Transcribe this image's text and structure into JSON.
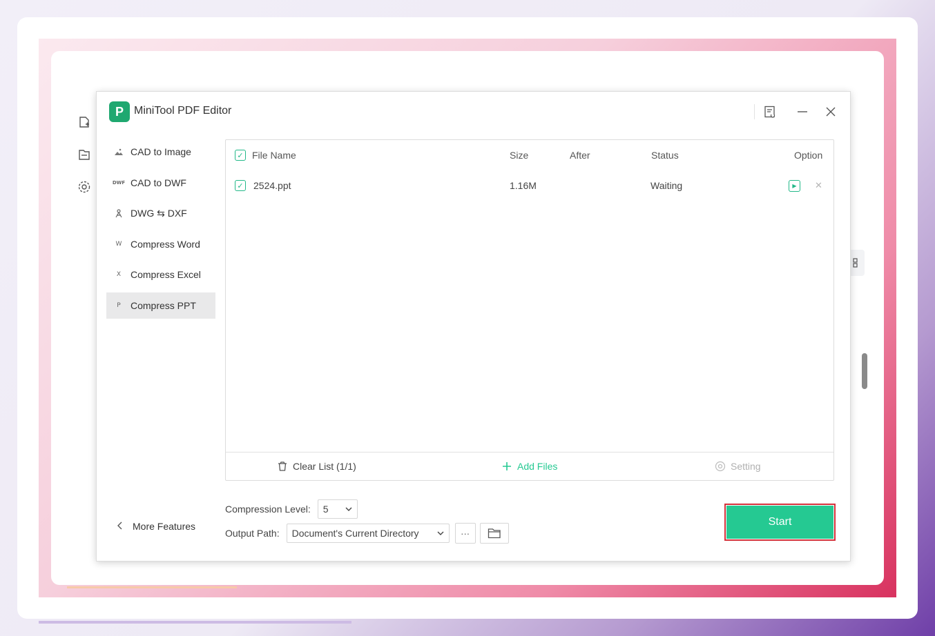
{
  "app": {
    "title": "MiniTool PDF Editor",
    "logo_letter": "P"
  },
  "sidebar": {
    "items": [
      {
        "label": "CAD to Image",
        "icon": "image-icon"
      },
      {
        "label": "CAD to DWF",
        "icon": "dwf-icon",
        "badge": "DWF"
      },
      {
        "label": "DWG ⇆ DXF",
        "icon": "dwg-dxf-icon"
      },
      {
        "label": "Compress Word",
        "icon": "word-compress-icon",
        "badge": "W"
      },
      {
        "label": "Compress Excel",
        "icon": "excel-compress-icon",
        "badge": "X"
      },
      {
        "label": "Compress PPT",
        "icon": "ppt-compress-icon",
        "badge": "P",
        "active": true
      }
    ],
    "more_features": "More Features"
  },
  "file_table": {
    "columns": {
      "file_name": "File Name",
      "size": "Size",
      "after": "After",
      "status": "Status",
      "option": "Option"
    },
    "rows": [
      {
        "file_name": "2524.ppt",
        "size": "1.16M",
        "after": "",
        "status": "Waiting",
        "checked": true
      }
    ]
  },
  "footer": {
    "clear_list": "Clear List (1/1)",
    "add_files": "Add Files",
    "setting": "Setting"
  },
  "options": {
    "compression_label": "Compression Level:",
    "compression_value": "5",
    "output_label": "Output Path:",
    "output_value": "Document's Current Directory",
    "browse_label": "···"
  },
  "start_button": "Start",
  "colors": {
    "accent": "#25c992",
    "highlight_border": "#d4303a",
    "logo": "#1fa870"
  }
}
